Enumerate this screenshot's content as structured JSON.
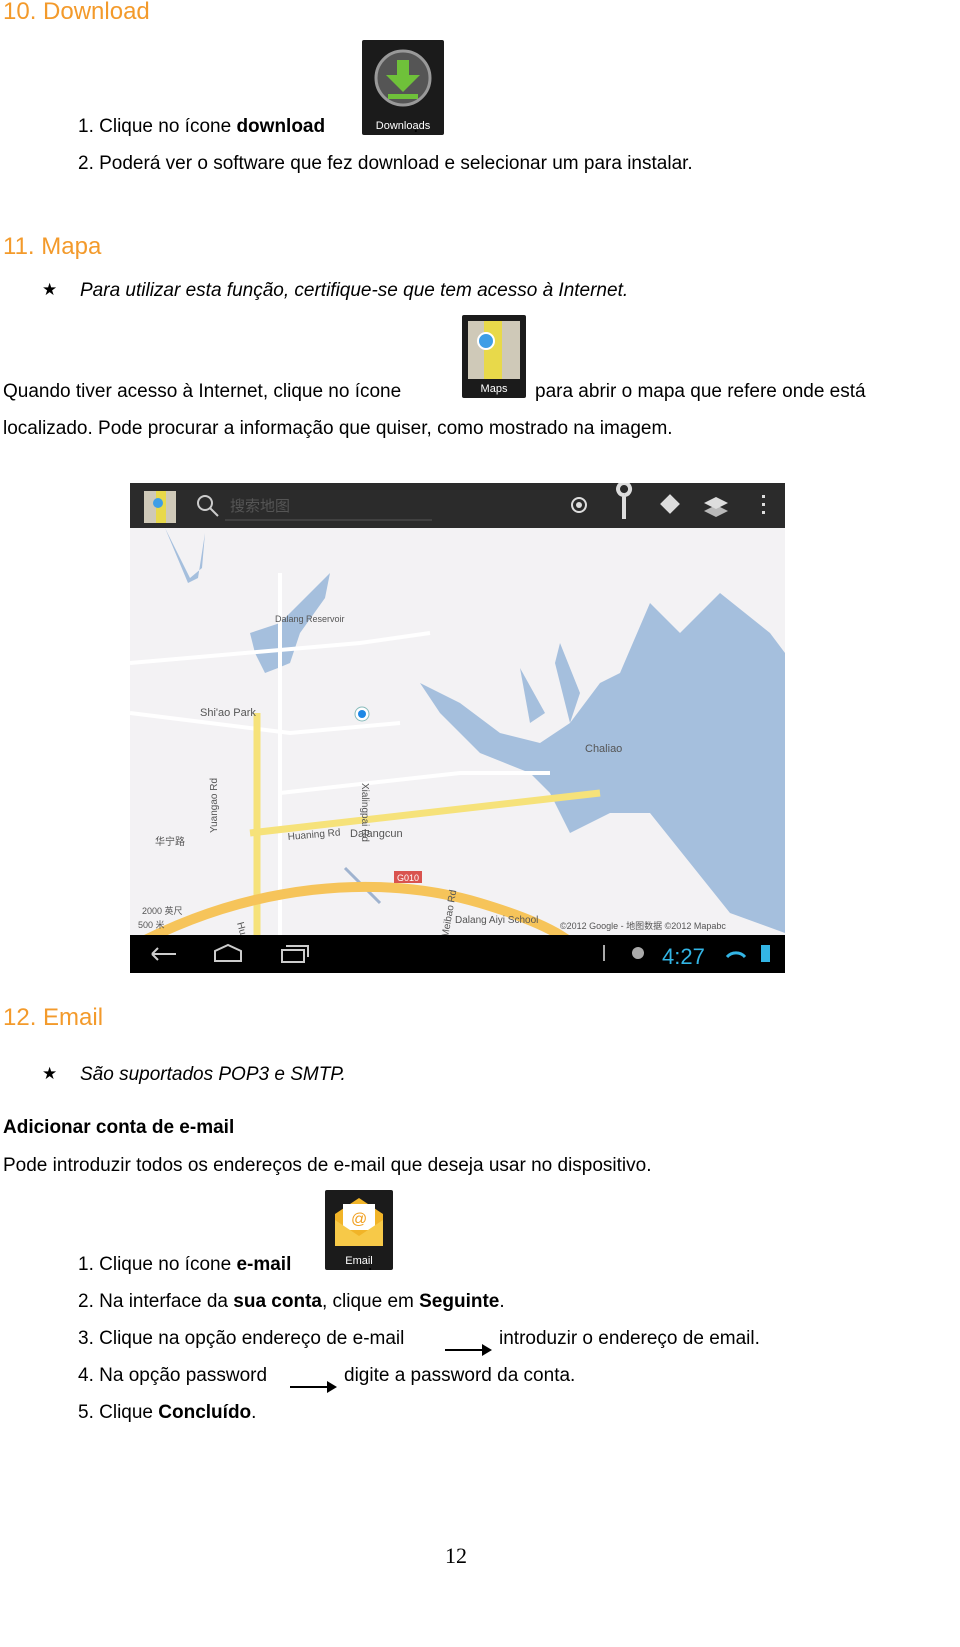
{
  "download": {
    "heading": "10. Download",
    "step1_pre": "1. Clique no ícone ",
    "step1_bold": "download",
    "step1_post": ".",
    "icon_label": "Downloads",
    "step2": "2. Poderá ver o software que fez download e selecionar um para instalar."
  },
  "mapa": {
    "heading": "11. Mapa",
    "note": "Para utilizar esta função, certifique-se que tem acesso à Internet.",
    "para1_pre": "Quando tiver acesso à Internet, clique no ícone",
    "para1_post": "para abrir o mapa que refere onde está",
    "icon_label": "Maps",
    "para2": "localizado. Pode procurar a informação que quiser, como mostrado na imagem."
  },
  "screenshot": {
    "search_placeholder": "搜索地图",
    "labels": {
      "reservoir": "Dalang Reservoir",
      "park": "Shi'ao Park",
      "chaliao": "Chaliao",
      "yuangao": "Yuangao Rd",
      "xialingpai": "Xialingpai Rd",
      "huaning_cn": "华宁路",
      "huaning": "Huaning Rd",
      "dalangcun": "Dalangcun",
      "meibao": "Meibao Rd",
      "huarong": "Huarong Rd",
      "g010": "G010",
      "dalang": "Dalang Aiyi School",
      "scale_ft": "2000 英尺",
      "scale_m": "500 米",
      "copyright": "©2012 Google - 地图数据 ©2012 Mapabc"
    },
    "time": "4:27",
    "colors": {
      "water": "#a5bfdd",
      "road": "#f6c45a",
      "bar": "#2b2b2b"
    }
  },
  "email": {
    "heading": "12. Email",
    "note": "São suportados POP3 e SMTP.",
    "subheading": "Adicionar conta de e-mail",
    "intro": "Pode introduzir todos os endereços de e-mail que deseja usar no dispositivo.",
    "icon_label": "Email",
    "step1_pre": "1. Clique no ícone ",
    "step1_bold": "e-mail",
    "step1_post": ".",
    "step2_pre": "2. Na interface da ",
    "step2_bold1": "sua conta",
    "step2_mid": ", clique em ",
    "step2_bold2": "Seguinte",
    "step2_post": ".",
    "step3_pre": "3. Clique na opção endereço de e-mail",
    "step3_post": "introduzir o endereço de email.",
    "step4_pre": "4. Na opção password",
    "step4_post": "digite a password da conta.",
    "step5_pre": "5. Clique ",
    "step5_bold": "Concluído",
    "step5_post": "."
  },
  "page_number": "12",
  "colors": {
    "heading": "#f39a2b"
  }
}
